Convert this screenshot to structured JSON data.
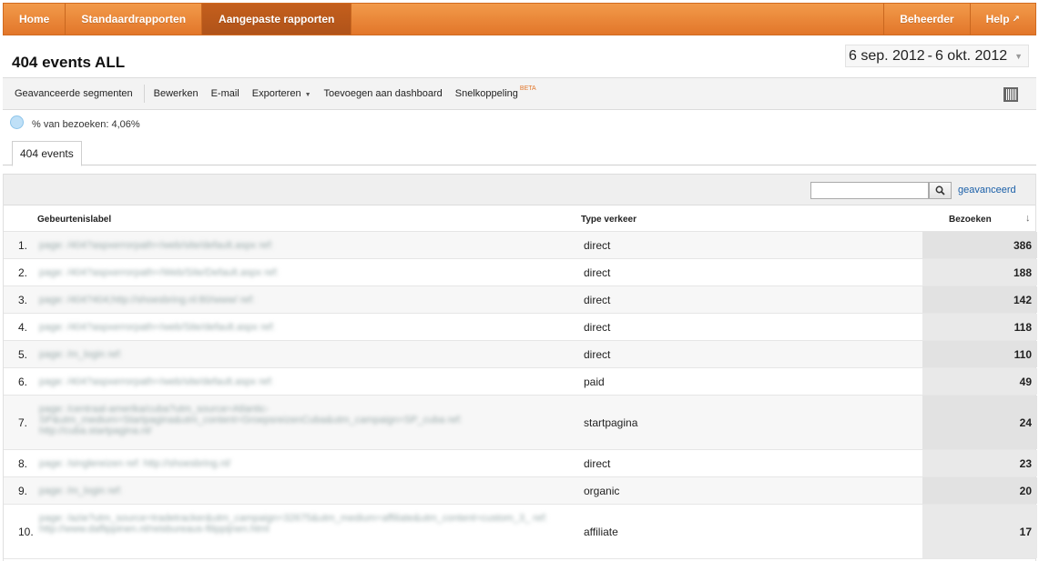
{
  "nav": {
    "home": "Home",
    "standard_reports": "Standaardrapporten",
    "custom_reports": "Aangepaste rapporten",
    "admin": "Beheerder",
    "help": "Help"
  },
  "report": {
    "title": "404 events ALL",
    "date_start": "6 sep. 2012",
    "date_sep": "-",
    "date_end": "6 okt. 2012"
  },
  "toolbar": {
    "advanced_segments": "Geavanceerde segmenten",
    "edit": "Bewerken",
    "email": "E-mail",
    "export": "Exporteren",
    "add_dashboard": "Toevoegen aan dashboard",
    "shortcut": "Snelkoppeling",
    "beta": "BETA"
  },
  "segment": {
    "text": "% van bezoeken: 4,06%"
  },
  "tabs": [
    "404 events"
  ],
  "search": {
    "placeholder": "",
    "advanced_link": "geavanceerd"
  },
  "table": {
    "columns": [
      "Gebeurtenislabel",
      "Type verkeer",
      "Bezoeken"
    ],
    "rows": [
      {
        "idx": "1.",
        "label": "page: /404?aspxerrorpath=/web/site/default.aspx ref:",
        "traffic": "direct",
        "visits": "386"
      },
      {
        "idx": "2.",
        "label": "page: /404?aspxerrorpath=/Web/Site/Default.aspx ref:",
        "traffic": "direct",
        "visits": "188"
      },
      {
        "idx": "3.",
        "label": "page: /404?404;http://shoesbring.nl:80/www/ ref:",
        "traffic": "direct",
        "visits": "142"
      },
      {
        "idx": "4.",
        "label": "page: /404?aspxerrorpath=/web/Site/default.aspx ref:",
        "traffic": "direct",
        "visits": "118"
      },
      {
        "idx": "5.",
        "label": "page: /m_login ref:",
        "traffic": "direct",
        "visits": "110"
      },
      {
        "idx": "6.",
        "label": "page: /404?aspxerrorpath=/web/site/default.aspx ref:",
        "traffic": "paid",
        "visits": "49"
      },
      {
        "idx": "7.",
        "label": "page: /centraal-amerika/cuba?utm_source=Atlantic-SP&utm_medium=Startpagina&utm_content=GroepsreizenCuba&utm_campaign=SP_cuba ref: http://cuba.startpagina.nl/",
        "traffic": "startpagina",
        "visits": "24"
      },
      {
        "idx": "8.",
        "label": "page: /singlereizen ref: http://shoesbring.nl/",
        "traffic": "direct",
        "visits": "23"
      },
      {
        "idx": "9.",
        "label": "page: /m_login ref:",
        "traffic": "organic",
        "visits": "20"
      },
      {
        "idx": "10.",
        "label": "page: /azie?utm_source=tradetracker&utm_campaign=32675&utm_medium=affiliate&utm_content=custom_3_ ref: http://www.daflippinen.nl/reisbureaus-filippijnen.html",
        "traffic": "affiliate",
        "visits": "17"
      }
    ]
  }
}
